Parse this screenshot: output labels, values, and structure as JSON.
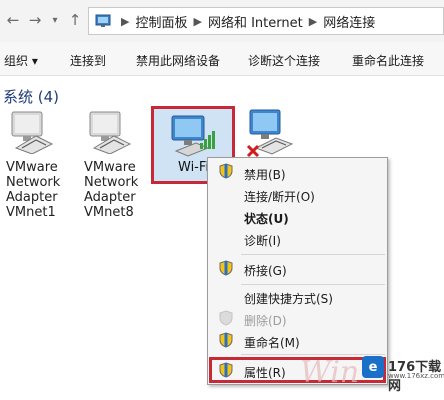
{
  "address": {
    "crumbs": [
      "控制面板",
      "网络和 Internet",
      "网络连接"
    ]
  },
  "toolbar": {
    "organize_label": "组织 ▾",
    "connect_label": "连接到",
    "disable_label": "禁用此网络设备",
    "diagnose_label": "诊断这个连接",
    "rename_label": "重命名此连接"
  },
  "group": {
    "title": "系统 (4)"
  },
  "adapters": [
    {
      "label": "VMware Network Adapter VMnet1"
    },
    {
      "label": "VMware Network Adapter VMnet8"
    },
    {
      "label": "Wi-Fi"
    },
    {
      "label": ""
    }
  ],
  "context_menu": {
    "items": [
      {
        "label": "禁用(B)"
      },
      {
        "label": "连接/断开(O)"
      },
      {
        "label": "状态(U)"
      },
      {
        "label": "诊断(I)"
      },
      {
        "label": "桥接(G)"
      },
      {
        "label": "创建快捷方式(S)"
      },
      {
        "label": "删除(D)"
      },
      {
        "label": "重命名(M)"
      },
      {
        "label": "属性(R)"
      }
    ]
  },
  "watermark": {
    "text": "176下载网",
    "sub": "www.176xz.com"
  },
  "colors": {
    "highlight": "#c62a36",
    "selection": "#cfe3f5",
    "group_title": "#1e3c78"
  }
}
